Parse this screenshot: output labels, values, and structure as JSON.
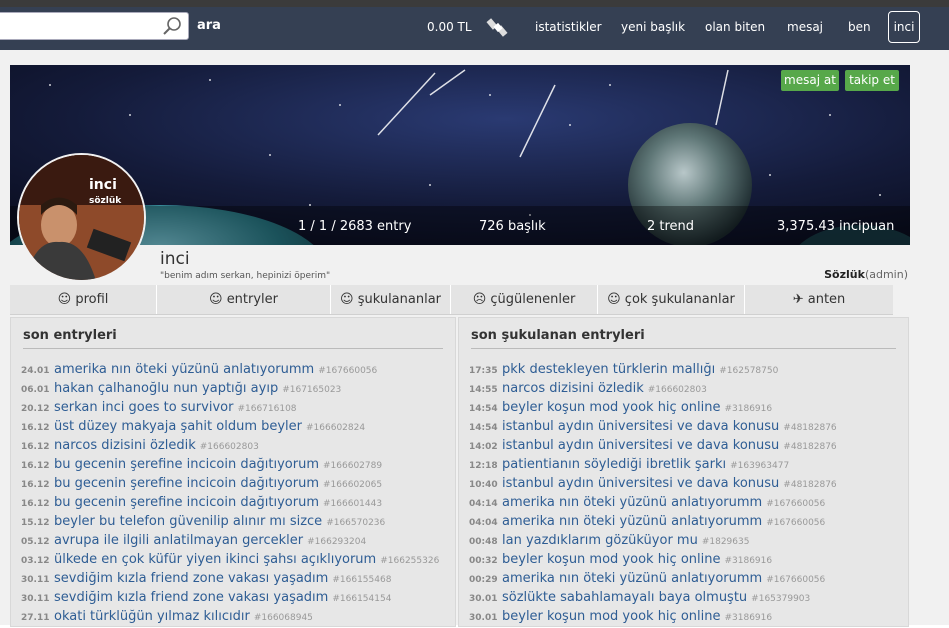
{
  "topbar": {
    "search_placeholder": "",
    "search_label": "ara",
    "balance": "0.00 TL",
    "nav": [
      "istatistikler",
      "yeni başlık",
      "olan biten",
      "mesaj",
      "ben"
    ],
    "active": "inci",
    "bg_color": "#354053"
  },
  "profile": {
    "message_button": "mesaj at",
    "follow_button": "takip et",
    "stats": {
      "entries": "1 / 1 / 2683 entry",
      "topics": "726 başlık",
      "trend": "2 trend",
      "points": "3,375.43 incipuan"
    },
    "name": "inci",
    "motto": "\"benim adım serkan, hepinizi öperim\"",
    "role": "Sözlük",
    "role_suffix": "(admin)",
    "avatar_text": "inci sözlük"
  },
  "tabs": [
    {
      "icon": "grin-icon",
      "label": "profil"
    },
    {
      "icon": "smile-icon",
      "label": "entryler"
    },
    {
      "icon": "smile-icon",
      "label": "şukulananlar"
    },
    {
      "icon": "frown-icon",
      "label": "çügülenenler"
    },
    {
      "icon": "smile-icon",
      "label": "çok şukulananlar"
    },
    {
      "icon": "antenna-icon",
      "label": "anten"
    }
  ],
  "left_panel": {
    "title": "son entryleri",
    "entries": [
      {
        "time": "24.01",
        "title": "amerika nın öteki yüzünü anlatıyorumm",
        "id": "#167660056"
      },
      {
        "time": "06.01",
        "title": "hakan çalhanoğlu nun yaptığı ayıp",
        "id": "#167165023"
      },
      {
        "time": "20.12",
        "title": "serkan inci goes to survivor",
        "id": "#166716108"
      },
      {
        "time": "16.12",
        "title": "üst düzey makyaja şahit oldum beyler",
        "id": "#166602824"
      },
      {
        "time": "16.12",
        "title": "narcos dizisini özledik",
        "id": "#166602803"
      },
      {
        "time": "16.12",
        "title": "bu gecenin şerefine incicoin dağıtıyorum",
        "id": "#166602789"
      },
      {
        "time": "16.12",
        "title": "bu gecenin şerefine incicoin dağıtıyorum",
        "id": "#166602065"
      },
      {
        "time": "16.12",
        "title": "bu gecenin şerefine incicoin dağıtıyorum",
        "id": "#166601443"
      },
      {
        "time": "15.12",
        "title": "beyler bu telefon güvenilip alınır mı sizce",
        "id": "#166570236"
      },
      {
        "time": "05.12",
        "title": "avrupa ile ilgili anlatilmayan gercekler",
        "id": "#166293204"
      },
      {
        "time": "03.12",
        "title": "ülkede en çok küfür yiyen ikinci şahsı açıklıyorum",
        "id": "#166255326"
      },
      {
        "time": "30.11",
        "title": "sevdiğim kızla friend zone vakası yaşadım",
        "id": "#166155468"
      },
      {
        "time": "30.11",
        "title": "sevdiğim kızla friend zone vakası yaşadım",
        "id": "#166154154"
      },
      {
        "time": "27.11",
        "title": "okati türklüğün yılmaz kılıcıdır",
        "id": "#166068945"
      }
    ]
  },
  "right_panel": {
    "title": "son şukulanan entryleri",
    "entries": [
      {
        "time": "17:35",
        "title": "pkk destekleyen türklerin mallığı",
        "id": "#162578750"
      },
      {
        "time": "14:55",
        "title": "narcos dizisini özledik",
        "id": "#166602803"
      },
      {
        "time": "14:54",
        "title": "beyler koşun mod yook hiç online",
        "id": "#3186916"
      },
      {
        "time": "14:54",
        "title": "istanbul aydın üniversitesi ve dava konusu",
        "id": "#48182876"
      },
      {
        "time": "14:02",
        "title": "istanbul aydın üniversitesi ve dava konusu",
        "id": "#48182876"
      },
      {
        "time": "12:18",
        "title": "patientianın söylediği ibretlik şarkı",
        "id": "#163963477"
      },
      {
        "time": "10:40",
        "title": "istanbul aydın üniversitesi ve dava konusu",
        "id": "#48182876"
      },
      {
        "time": "04:14",
        "title": "amerika nın öteki yüzünü anlatıyorumm",
        "id": "#167660056"
      },
      {
        "time": "04:04",
        "title": "amerika nın öteki yüzünü anlatıyorumm",
        "id": "#167660056"
      },
      {
        "time": "00:48",
        "title": "lan yazdıklarım gözüküyor mu",
        "id": "#1829635"
      },
      {
        "time": "00:32",
        "title": "beyler koşun mod yook hiç online",
        "id": "#3186916"
      },
      {
        "time": "00:29",
        "title": "amerika nın öteki yüzünü anlatıyorumm",
        "id": "#167660056"
      },
      {
        "time": "30.01",
        "title": "sözlükte sabahlamayalı baya olmuştu",
        "id": "#165379903"
      },
      {
        "time": "30.01",
        "title": "beyler koşun mod yook hiç online",
        "id": "#3186916"
      }
    ]
  },
  "colors": {
    "link": "#2e5d94",
    "green_button": "#57a84a",
    "panel_bg": "#e7e7e7"
  }
}
